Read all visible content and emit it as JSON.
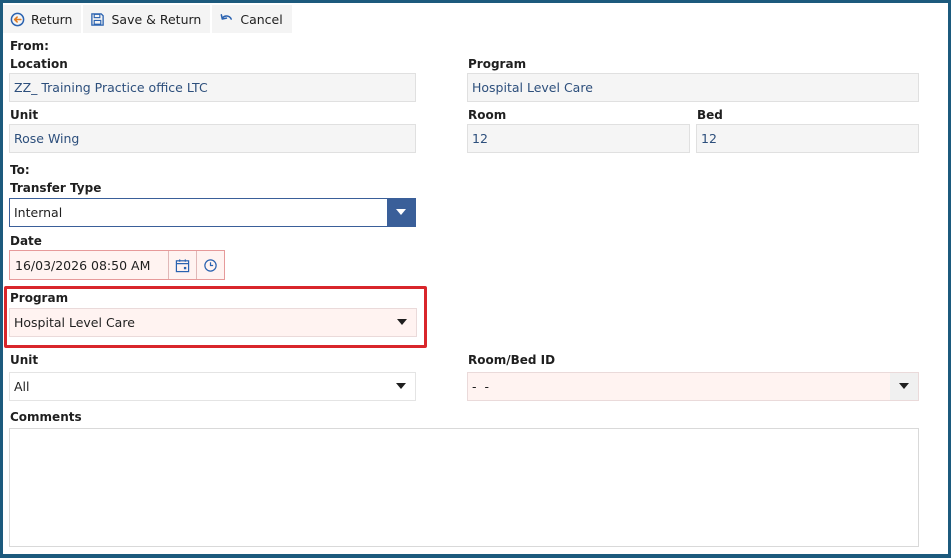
{
  "toolbar": {
    "return_label": "Return",
    "save_return_label": "Save & Return",
    "cancel_label": "Cancel"
  },
  "from": {
    "heading": "From:",
    "location_label": "Location",
    "location_value": "ZZ_ Training Practice office LTC",
    "program_label": "Program",
    "program_value": "Hospital Level Care",
    "unit_label": "Unit",
    "unit_value": "Rose Wing",
    "room_label": "Room",
    "room_value": "12",
    "bed_label": "Bed",
    "bed_value": "12"
  },
  "to": {
    "heading": "To:",
    "transfer_type_label": "Transfer Type",
    "transfer_type_value": "Internal",
    "date_label": "Date",
    "date_value": "16/03/2026 08:50 AM",
    "program_label": "Program",
    "program_value": "Hospital Level Care",
    "unit_label": "Unit",
    "unit_value": "All",
    "room_bed_label": "Room/Bed ID",
    "room_bed_value": "-  -",
    "comments_label": "Comments",
    "comments_value": ""
  },
  "icons": {
    "return": "return-arrow-icon",
    "save": "save-icon",
    "cancel": "undo-icon",
    "calendar": "calendar-icon",
    "clock": "clock-icon",
    "dropdown": "caret-down-icon"
  },
  "colors": {
    "frame": "#1c5a7d",
    "highlight": "#d9262b",
    "dropdown_blue": "#3a5f99",
    "readonly_text": "#2d4f7c",
    "required_bg": "#fff3f1"
  }
}
